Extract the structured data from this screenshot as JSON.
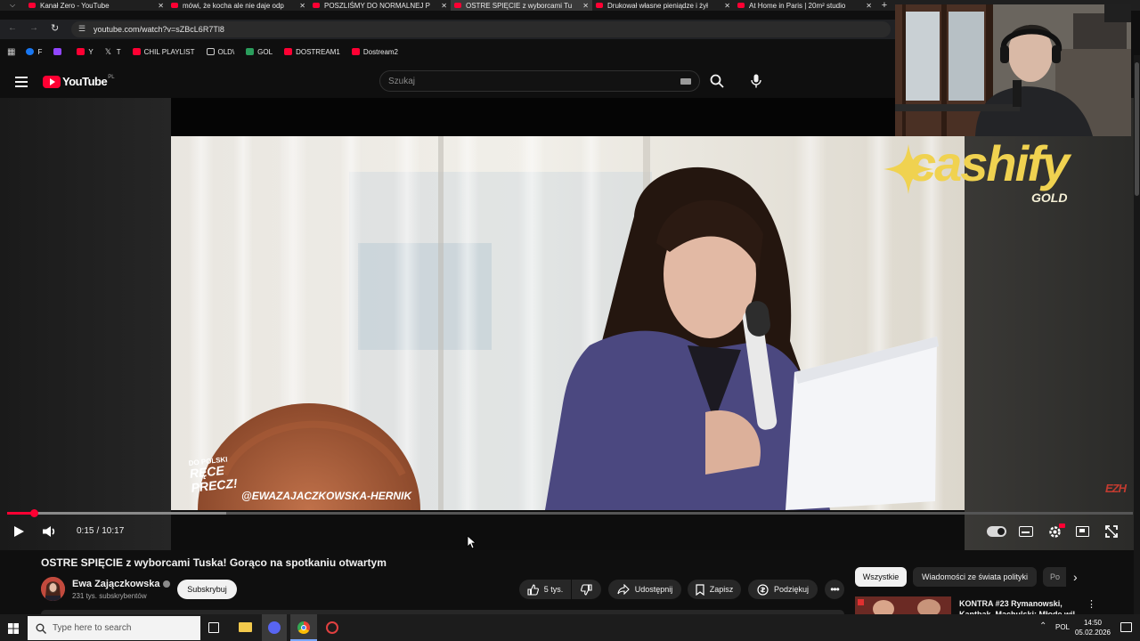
{
  "browser": {
    "tabs": [
      {
        "label": "Kanał Zero - YouTube",
        "active": false
      },
      {
        "label": "mówi, że kocha ale nie daje odp",
        "active": false
      },
      {
        "label": "POSZLIŚMY DO NORMALNEJ P",
        "active": false
      },
      {
        "label": "OSTRE SPIĘCIE z wyborcami Tu",
        "active": true
      },
      {
        "label": "Drukował własne pieniądze i żył",
        "active": false
      },
      {
        "label": "At Home in Paris | 20m² studio",
        "active": false
      }
    ],
    "url": "youtube.com/watch?v=sZBcL6R7Tl8",
    "bookmarks": [
      {
        "label": "F",
        "icon": "facebook-icon",
        "color": "#1877f2"
      },
      {
        "label": "",
        "icon": "twitch-icon",
        "color": "#9146ff"
      },
      {
        "label": "Y",
        "icon": "youtube-icon",
        "color": "#ff0033"
      },
      {
        "label": "T",
        "icon": "x-icon",
        "color": "#dddddd"
      },
      {
        "label": "CHIL PLAYLIST",
        "icon": "youtube-icon",
        "color": "#ff0033"
      },
      {
        "label": "OLD\\",
        "icon": "folder-icon",
        "color": "#cccccc"
      },
      {
        "label": "GOL",
        "icon": "gol-icon",
        "color": "#2a9d5c"
      },
      {
        "label": "DOSTREAM1",
        "icon": "youtube-icon",
        "color": "#ff0033"
      },
      {
        "label": "Dostream2",
        "icon": "youtube-icon",
        "color": "#ff0033"
      }
    ]
  },
  "youtube": {
    "logo_text": "YouTube",
    "region": "PL",
    "search_placeholder": "Szukaj",
    "accent": "#ff0033"
  },
  "video": {
    "overlay_handle": "@EWAZAJACZKOWSKA-HERNIK",
    "overlay_logo": [
      "DO POLSKI",
      "RĘCE",
      "PRECZ!"
    ],
    "watermark": "EZH",
    "time_current": "0:15",
    "time_separator": "/",
    "time_total": "10:17",
    "progress_fraction": 0.024,
    "buffered_fraction": 0.195
  },
  "info": {
    "title": "OSTRE SPIĘCIE z wyborcami Tuska! Gorąco na spotkaniu otwartym",
    "channel_name": "Ewa Zajączkowska",
    "subscribers": "231 tys. subskrybentów",
    "subscribe_label": "Subskrybuj",
    "likes": "5 tys.",
    "share_label": "Udostępnij",
    "save_label": "Zapisz",
    "thanks_label": "Podziękuj"
  },
  "sidebar": {
    "chips": [
      "Wszystkie",
      "Wiadomości ze świata polityki",
      "Po"
    ],
    "next_video_title": "KONTRA #23 Rymanowski, Kantbak, Machulski: Młode wil"
  },
  "overlay": {
    "brand_main": "cashify",
    "brand_sub": "GOLD",
    "brand_color": "#f0d250"
  },
  "taskbar": {
    "search_placeholder": "Type here to search",
    "language": "POL",
    "time": "14:50",
    "date": "05.02.2026"
  }
}
